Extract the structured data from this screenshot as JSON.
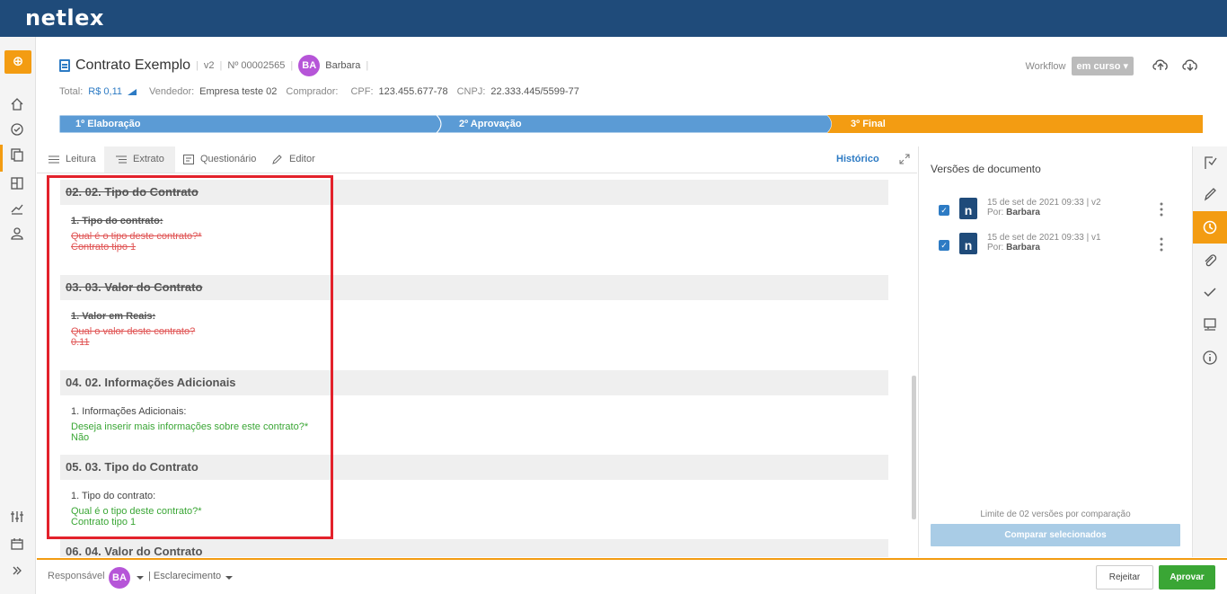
{
  "app": {
    "logo": "netlex"
  },
  "doc": {
    "title": "Contrato Exemplo",
    "version": "v2",
    "number": "Nº 00002565",
    "user_initials": "BA",
    "user_name": "Barbara",
    "total_label": "Total:",
    "total_value": "R$ 0,11",
    "seller_label": "Vendedor:",
    "seller_value": "Empresa teste 02",
    "buyer_label": "Comprador:",
    "cpf_label": "CPF:",
    "cpf_value": "123.455.677-78",
    "cnpj_label": "CNPJ:",
    "cnpj_value": "22.333.445/5599-77"
  },
  "workflow": {
    "label": "Workflow",
    "status": "em curso ▾"
  },
  "stages": [
    {
      "label": "1º Elaboração",
      "color": "#5b9bd5"
    },
    {
      "label": "2º Aprovação",
      "color": "#5b9bd5"
    },
    {
      "label": "3º Final",
      "color": "#f39c12"
    }
  ],
  "tabs": {
    "leitura": "Leitura",
    "extrato": "Extrato",
    "questionario": "Questionário",
    "editor": "Editor",
    "historico": "Histórico"
  },
  "sections": [
    {
      "title": "02. 02. Tipo do Contrato",
      "question": "1. Tipo do contrato:",
      "prompt": "Qual é o tipo deste contrato?*",
      "answer": "Contrato tipo 1",
      "state": "removed"
    },
    {
      "title": "03. 03. Valor do Contrato",
      "question": "1. Valor em Reais:",
      "prompt": "Qual o valor deste contrato?",
      "answer": "0.11",
      "state": "removed"
    },
    {
      "title": "04. 02. Informações Adicionais",
      "question": "1. Informações Adicionais:",
      "prompt": "Deseja inserir mais informações sobre este contrato?*",
      "answer": "Não",
      "state": "added"
    },
    {
      "title": "05. 03. Tipo do Contrato",
      "question": "1. Tipo do contrato:",
      "prompt": "Qual é o tipo deste contrato?*",
      "answer": "Contrato tipo 1",
      "state": "added"
    },
    {
      "title": "06. 04. Valor do Contrato"
    }
  ],
  "versions_panel": {
    "title": "Versões de documento",
    "items": [
      {
        "date": "15 de set de 2021 09:33 | v2",
        "by_label": "Por:",
        "by": "Barbara"
      },
      {
        "date": "15 de set de 2021 09:33 | v1",
        "by_label": "Por:",
        "by": "Barbara"
      }
    ],
    "limit_text": "Limite de 02 versões por comparação",
    "compare_label": "Comparar selecionados"
  },
  "footer": {
    "responsible_label": "Responsável",
    "initials": "BA",
    "clarification": "Esclarecimento",
    "reject": "Rejeitar",
    "approve": "Aprovar"
  },
  "icons": {
    "left_rail": [
      "home-icon",
      "clock-check-icon",
      "documents-icon",
      "board-icon",
      "chart-icon",
      "user-icon",
      "sliders-icon",
      "calendar-icon",
      "expand-icon"
    ],
    "right_rail": [
      "flag-icon",
      "pen-icon",
      "history-icon",
      "paperclip-icon",
      "check-icon",
      "comment-icon",
      "info-icon"
    ]
  },
  "colors": {
    "brand": "#1f4b7a",
    "accent": "#f39c12",
    "added": "#3aa635",
    "removed": "#e05555",
    "highlight": "#e3212b"
  }
}
